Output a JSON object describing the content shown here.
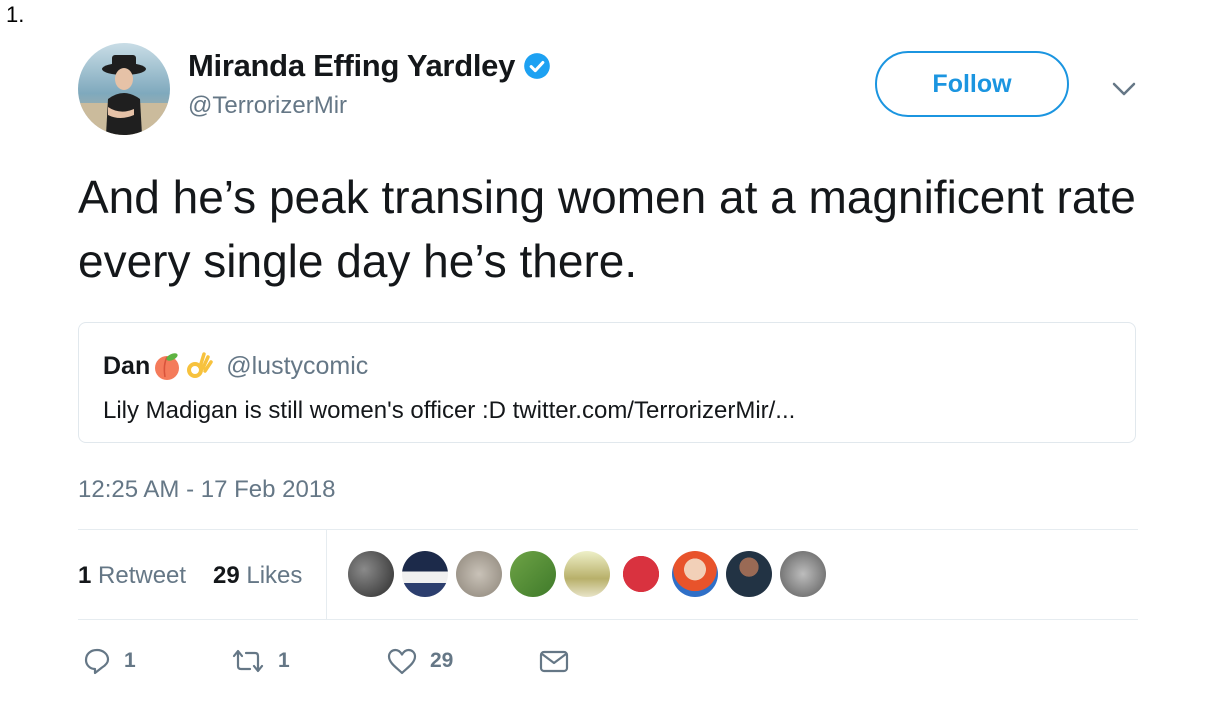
{
  "list_marker": "1.",
  "tweet": {
    "author": {
      "name": "Miranda Effing Yardley",
      "handle": "@TerrorizerMir",
      "verified": true,
      "avatar_icon": "profile-photo"
    },
    "follow_label": "Follow",
    "menu_icon": "chevron-down-icon",
    "text": "And he’s peak transing women at a magnificent rate every single day he’s there.",
    "quoted": {
      "name": "Dan",
      "emojis": [
        "peach-emoji",
        "ok-hand-emoji"
      ],
      "handle": "@lustycomic",
      "text": "Lily Madigan is still women's officer :D twitter.com/TerrorizerMir/..."
    },
    "timestamp": "12:25 AM - 17 Feb 2018",
    "stats": {
      "retweets_count": "1",
      "retweets_label": "Retweet",
      "likes_count": "29",
      "likes_label": "Likes"
    },
    "liker_avatars": [
      "liker-1",
      "liker-2",
      "liker-3",
      "liker-4",
      "liker-5",
      "liker-6",
      "liker-7",
      "liker-8",
      "liker-9"
    ],
    "actions": {
      "reply_count": "1",
      "retweet_count": "1",
      "like_count": "29"
    }
  },
  "colors": {
    "accent": "#1b95e0",
    "muted": "#657786",
    "text": "#14171a",
    "border": "#e6ecf0"
  }
}
